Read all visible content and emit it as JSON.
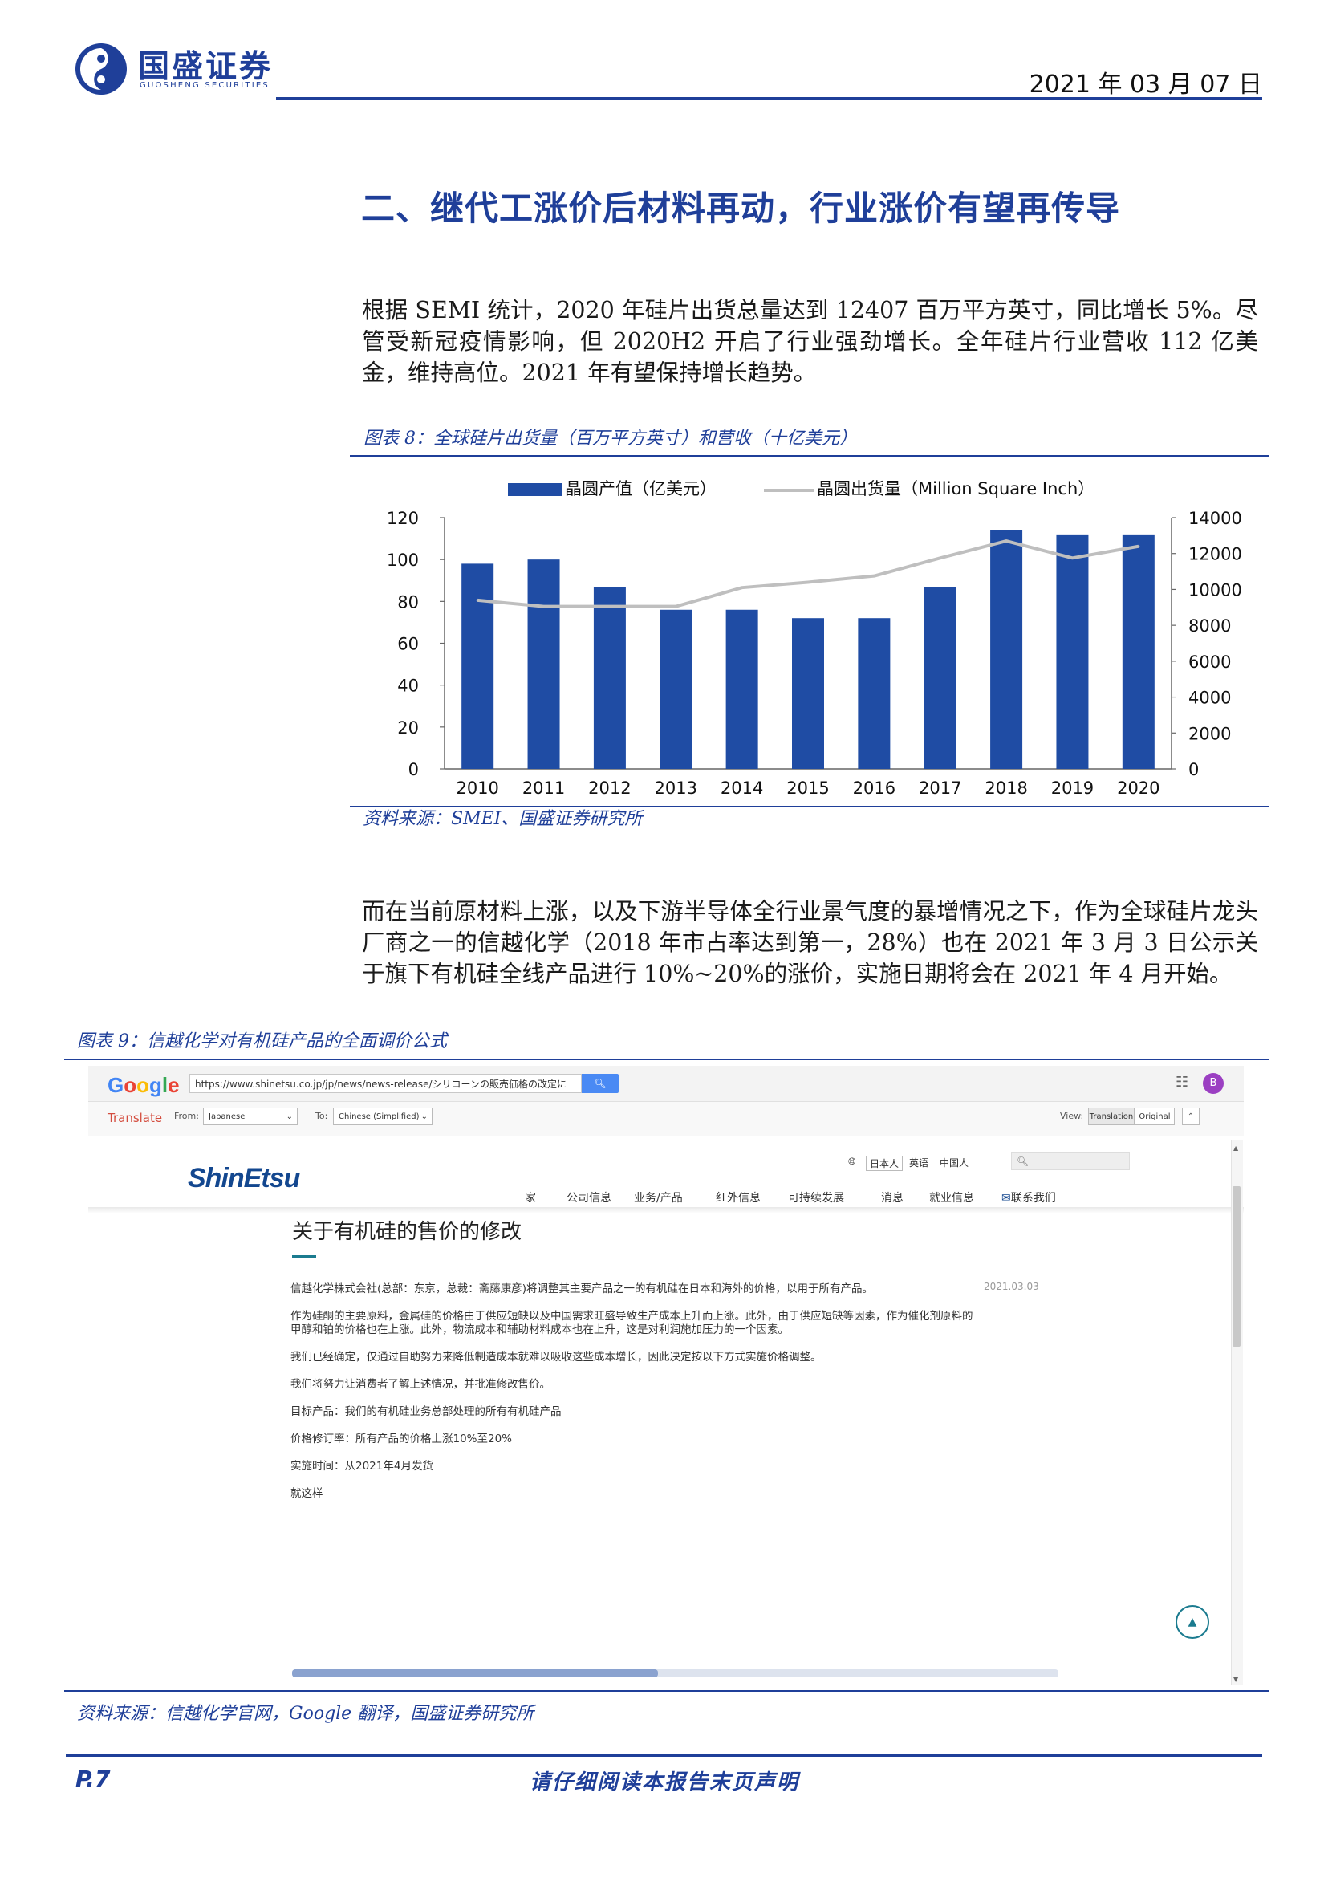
{
  "header": {
    "logo_cn": "国盛证券",
    "logo_en": "GUOSHENG SECURITIES",
    "date": "2021 年 03 月 07 日"
  },
  "section_title": "二、继代工涨价后材料再动，行业涨价有望再传导",
  "paragraphs": {
    "p1": "根据 SEMI 统计，2020 年硅片出货总量达到 12407 百万平方英寸，同比增长 5%。尽管受新冠疫情影响，但 2020H2 开启了行业强劲增长。全年硅片行业营收 112 亿美金，维持高位。2021 年有望保持增长趋势。",
    "p2": "而在当前原材料上涨，以及下游半导体全行业景气度的暴增情况之下，作为全球硅片龙头厂商之一的信越化学（2018 年市占率达到第一，28%）也在 2021 年 3 月 3 日公示关于旗下有机硅全线产品进行 10%~20%的涨价，实施日期将会在 2021 年 4 月开始。"
  },
  "figure8": {
    "caption": "图表 8：全球硅片出货量（百万平方英寸）和营收（十亿美元）",
    "source": "资料来源：SMEI、国盛证券研究所"
  },
  "chart_data": {
    "type": "bar",
    "categories": [
      "2010",
      "2011",
      "2012",
      "2013",
      "2014",
      "2015",
      "2016",
      "2017",
      "2018",
      "2019",
      "2020"
    ],
    "series": [
      {
        "name": "晶圆产值（亿美元）",
        "type": "bar",
        "axis": "left",
        "color": "#1f4ca4",
        "values": [
          98,
          100,
          87,
          76,
          76,
          72,
          72,
          87,
          114,
          112,
          112
        ]
      },
      {
        "name": "晶圆出货量（Million Square Inch）",
        "type": "line",
        "axis": "right",
        "color": "#bfbfbf",
        "values": [
          9400,
          9050,
          9050,
          9050,
          10100,
          10400,
          10750,
          11750,
          12700,
          11750,
          12400
        ]
      }
    ],
    "y_left": {
      "min": 0,
      "max": 120,
      "ticks": [
        "0",
        "20",
        "40",
        "60",
        "80",
        "100",
        "120"
      ]
    },
    "y_right": {
      "min": 0,
      "max": 14000,
      "ticks": [
        "0",
        "2000",
        "4000",
        "6000",
        "8000",
        "10000",
        "12000",
        "14000"
      ]
    },
    "legend_position": "top",
    "grid": false
  },
  "figure9": {
    "caption": "图表 9：信越化学对有机硅产品的全面调价公式",
    "source": "资料来源：信越化学官网，Google 翻译，国盛证券研究所"
  },
  "browser": {
    "google_logo": "Google",
    "url": "https://www.shinetsu.co.jp/jp/news/news-release/シリコーンの販売価格の改定に",
    "translate_label": "Translate",
    "from_label": "From:",
    "from_value": "Japanese",
    "to_label": "To:",
    "to_value": "Chinese (Simplified)",
    "view_label": "View:",
    "view_translation": "Translation",
    "view_original": "Original",
    "avatar_letter": "B",
    "site_logo": "ShinEtsu",
    "languages": [
      "日本人",
      "英语",
      "中国人"
    ],
    "nav": [
      "家",
      "公司信息",
      "业务/产品",
      "红外信息",
      "可持续发展",
      "消息",
      "就业信息",
      "联系我们"
    ],
    "article_title": "关于有机硅的售价的修改",
    "article_date": "2021.03.03",
    "article_lines": [
      "信越化学株式会社(总部：东京，总裁：斋藤康彦)将调整其主要产品之一的有机硅在日本和海外的价格，以用于所有产品。",
      "作为硅酮的主要原料，金属硅的价格由于供应短缺以及中国需求旺盛导致生产成本上升而上涨。此外，由于供应短缺等因素，作为催化剂原料的",
      "甲醇和铂的价格也在上涨。此外，物流成本和辅助材料成本也在上升，这是对利润施加压力的一个因素。",
      "我们已经确定，仅通过自助努力来降低制造成本就难以吸收这些成本增长，因此决定按以下方式实施价格调整。",
      "我们将努力让消费者了解上述情况，并批准修改售价。",
      "目标产品：我们的有机硅业务总部处理的所有有机硅产品",
      "价格修订率：所有产品的价格上涨10%至20%",
      "实施时间：从2021年4月发货",
      "就这样"
    ]
  },
  "footer": {
    "page": "P.7",
    "note": "请仔细阅读本报告末页声明"
  }
}
